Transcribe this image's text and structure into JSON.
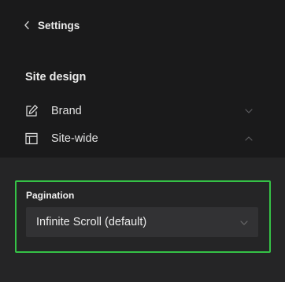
{
  "header": {
    "back_label": "Settings"
  },
  "site_design": {
    "title": "Site design",
    "items": [
      {
        "label": "Brand",
        "icon": "pencil-edit-icon",
        "expanded": false
      },
      {
        "label": "Site-wide",
        "icon": "layout-icon",
        "expanded": true
      }
    ]
  },
  "pagination": {
    "label": "Pagination",
    "selected": "Infinite Scroll (default)"
  },
  "colors": {
    "highlight_border": "#35c246",
    "panel_dark": "#1a1a1b",
    "panel_light": "#252526",
    "select_bg": "#323234"
  }
}
